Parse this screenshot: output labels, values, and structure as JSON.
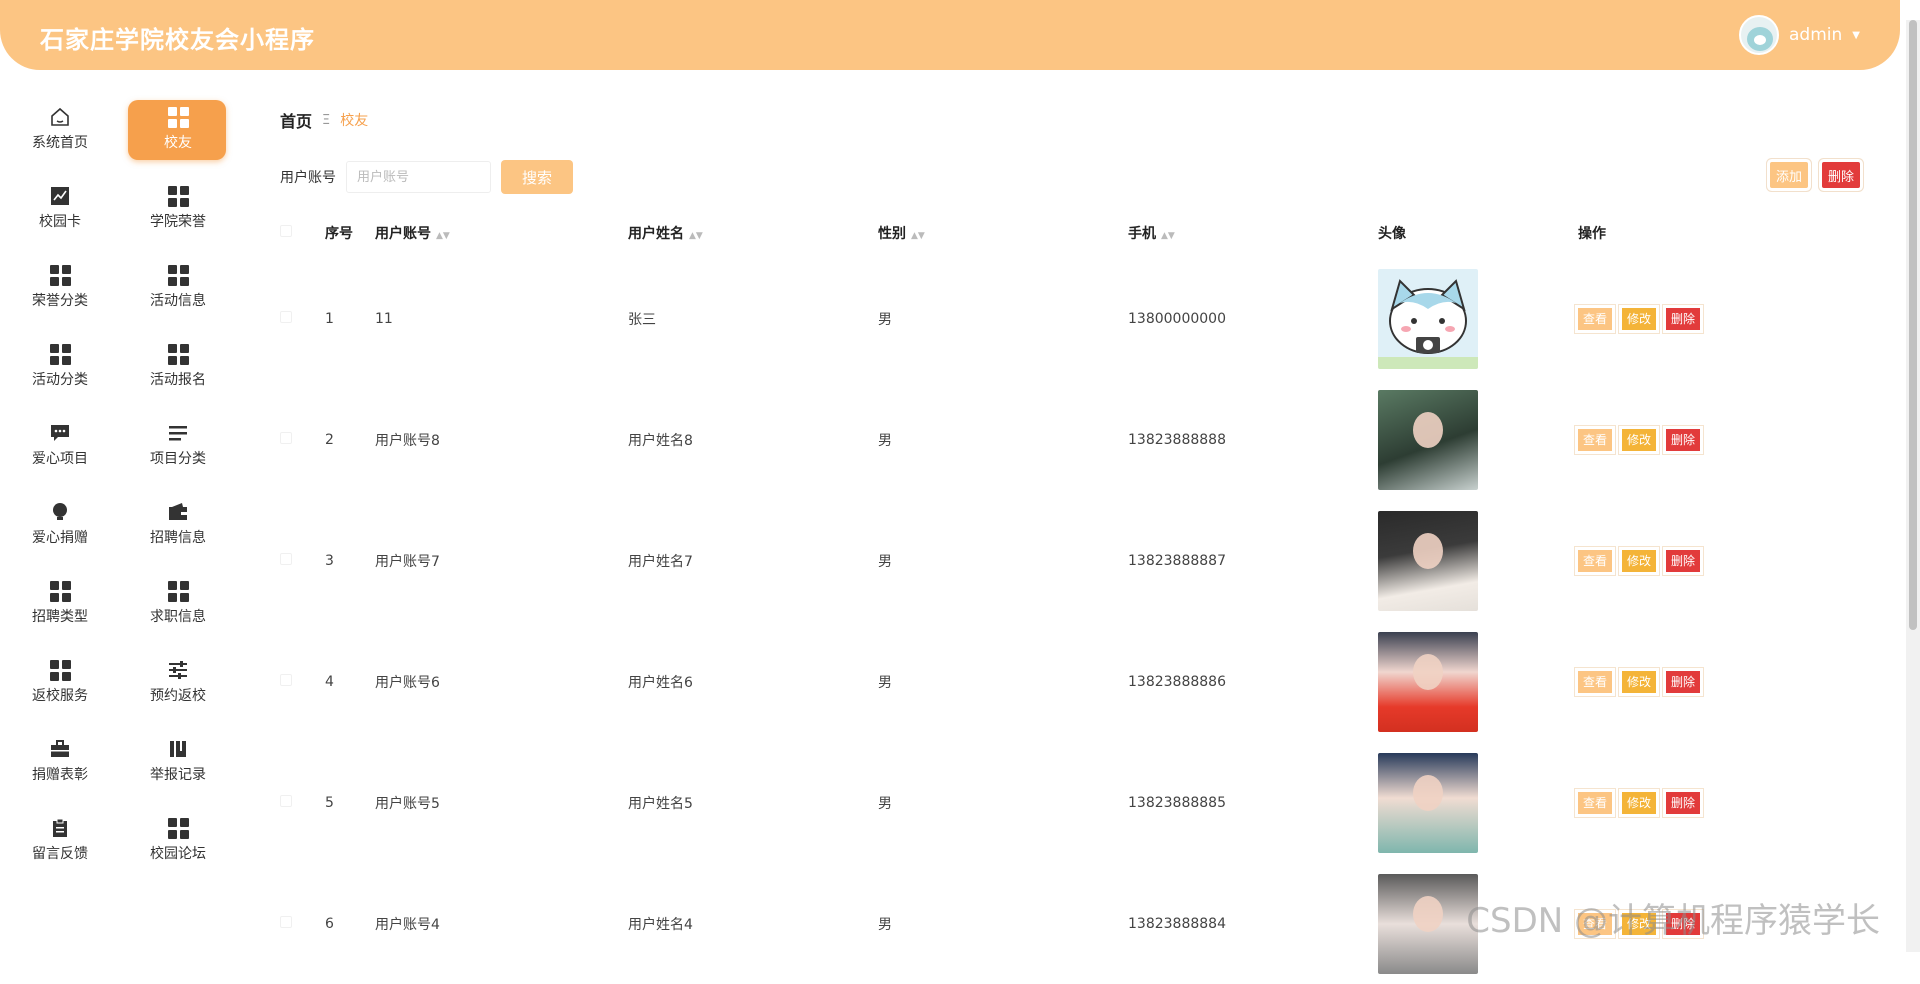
{
  "header": {
    "title": "石家庄学院校友会小程序",
    "username": "admin"
  },
  "sidebar": {
    "items": [
      {
        "label": "系统首页",
        "icon": "home-icon"
      },
      {
        "label": "校友",
        "icon": "grid-icon",
        "active": true
      },
      {
        "label": "校园卡",
        "icon": "chart-icon"
      },
      {
        "label": "学院荣誉",
        "icon": "grid-icon"
      },
      {
        "label": "荣誉分类",
        "icon": "grid-icon"
      },
      {
        "label": "活动信息",
        "icon": "grid-icon"
      },
      {
        "label": "活动分类",
        "icon": "grid-icon"
      },
      {
        "label": "活动报名",
        "icon": "grid-icon"
      },
      {
        "label": "爱心项目",
        "icon": "chat-icon"
      },
      {
        "label": "项目分类",
        "icon": "list-icon"
      },
      {
        "label": "爱心捐赠",
        "icon": "bulb-icon"
      },
      {
        "label": "招聘信息",
        "icon": "wallet-icon"
      },
      {
        "label": "招聘类型",
        "icon": "grid-icon"
      },
      {
        "label": "求职信息",
        "icon": "grid-icon"
      },
      {
        "label": "返校服务",
        "icon": "grid-icon"
      },
      {
        "label": "预约返校",
        "icon": "sliders-icon"
      },
      {
        "label": "捐赠表彰",
        "icon": "briefcase-icon"
      },
      {
        "label": "举报记录",
        "icon": "book-icon"
      },
      {
        "label": "留言反馈",
        "icon": "clipboard-icon"
      },
      {
        "label": "校园论坛",
        "icon": "grid-icon"
      }
    ]
  },
  "breadcrumb": {
    "home": "首页",
    "separator": "Ξ",
    "current": "校友"
  },
  "search": {
    "label": "用户账号",
    "placeholder": "用户账号",
    "button": "搜索"
  },
  "actions": {
    "add": "添加",
    "delete": "删除"
  },
  "table": {
    "headers": {
      "index": "序号",
      "account": "用户账号",
      "name": "用户姓名",
      "gender": "性别",
      "phone": "手机",
      "avatar": "头像",
      "ops": "操作"
    },
    "op_labels": {
      "view": "查看",
      "edit": "修改",
      "delete": "删除"
    },
    "rows": [
      {
        "index": "1",
        "account": "11",
        "name": "张三",
        "gender": "男",
        "phone": "13800000000"
      },
      {
        "index": "2",
        "account": "用户账号8",
        "name": "用户姓名8",
        "gender": "男",
        "phone": "13823888888"
      },
      {
        "index": "3",
        "account": "用户账号7",
        "name": "用户姓名7",
        "gender": "男",
        "phone": "13823888887"
      },
      {
        "index": "4",
        "account": "用户账号6",
        "name": "用户姓名6",
        "gender": "男",
        "phone": "13823888886"
      },
      {
        "index": "5",
        "account": "用户账号5",
        "name": "用户姓名5",
        "gender": "男",
        "phone": "13823888885"
      },
      {
        "index": "6",
        "account": "用户账号4",
        "name": "用户姓名4",
        "gender": "男",
        "phone": "13823888884"
      }
    ]
  },
  "watermark": "CSDN @计算机程序猿学长",
  "colors": {
    "accent": "#fcc583",
    "active": "#f6a04c",
    "edit": "#f4b438",
    "danger": "#e23b3b"
  }
}
